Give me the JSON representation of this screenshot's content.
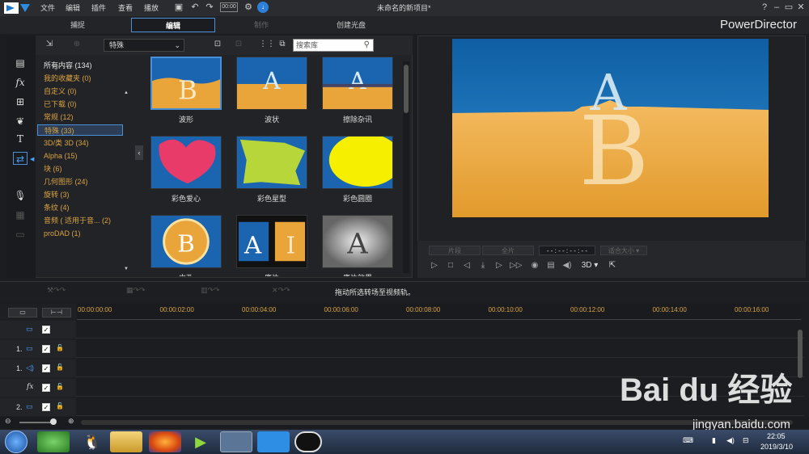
{
  "titlebar": {
    "menus": [
      "文件",
      "编辑",
      "插件",
      "查看",
      "播放"
    ],
    "timecode_icon": "00:00",
    "project_title": "未命名的新项目*",
    "window_buttons": [
      "?",
      "–",
      "▭",
      "✕"
    ]
  },
  "modes": {
    "tabs": [
      "捕捉",
      "编辑",
      "制作",
      "创建光盘"
    ],
    "brand": "PowerDirector"
  },
  "library": {
    "category_select": "特殊",
    "search_placeholder": "搜索库",
    "categories": [
      {
        "label": "所有内容 (134)",
        "style": "white"
      },
      {
        "label": "我的收藏夹 (0)",
        "style": "orange"
      },
      {
        "label": "自定义 (0)",
        "style": "orange"
      },
      {
        "label": "已下载 (0)",
        "style": "orange"
      },
      {
        "label": "常规 (12)",
        "style": "orange"
      },
      {
        "label": "特殊 (33)",
        "style": "orange",
        "selected": true
      },
      {
        "label": "3D/类 3D (34)",
        "style": "orange"
      },
      {
        "label": "Alpha (15)",
        "style": "orange"
      },
      {
        "label": "块 (6)",
        "style": "orange"
      },
      {
        "label": "几何图形 (24)",
        "style": "orange"
      },
      {
        "label": "旋转 (3)",
        "style": "orange"
      },
      {
        "label": "条纹 (4)",
        "style": "orange"
      },
      {
        "label": "音频 ( 适用于音... (2)",
        "style": "orange"
      },
      {
        "label": "proDAD (1)",
        "style": "orange"
      }
    ],
    "transitions": [
      {
        "label": "波形",
        "kind": "wave-b"
      },
      {
        "label": "波状",
        "kind": "wave-a"
      },
      {
        "label": "擦除杂讯",
        "kind": "noise"
      },
      {
        "label": "彩色爱心",
        "kind": "heart"
      },
      {
        "label": "彩色星型",
        "kind": "star"
      },
      {
        "label": "彩色圆圈",
        "kind": "circle"
      },
      {
        "label": "内孔",
        "kind": "hole"
      },
      {
        "label": "底片",
        "kind": "film"
      },
      {
        "label": "底片效果",
        "kind": "negative"
      }
    ]
  },
  "preview": {
    "btn_clip": "片段",
    "btn_movie": "全片",
    "timecode": "- - : - - : - - : - -",
    "fit_select": "适合大小",
    "mode_3d": "3D"
  },
  "timeline": {
    "hint": "拖动所选转场至视频轨。",
    "ticks": [
      "00:00:00:00",
      "00:00:02:00",
      "00:00:04:00",
      "00:00:06:00",
      "00:00:08:00",
      "00:00:10:00",
      "00:00:12:00",
      "00:00:14:00",
      "00:00:16:00"
    ],
    "tracks": [
      {
        "label": "",
        "icon": "video"
      },
      {
        "label": "1.",
        "icon": "video"
      },
      {
        "label": "1.",
        "icon": "audio"
      },
      {
        "label": "fx",
        "icon": "fx"
      },
      {
        "label": "2.",
        "icon": "video"
      }
    ]
  },
  "taskbar": {
    "time": "22:05",
    "date": "2019/3/10"
  },
  "watermark": {
    "brand": "Bai du 经验",
    "url": "jingyan.baidu.com"
  },
  "colors": {
    "accent": "#4a90d9",
    "category_text": "#d9a342",
    "panel_bg": "#222327"
  }
}
